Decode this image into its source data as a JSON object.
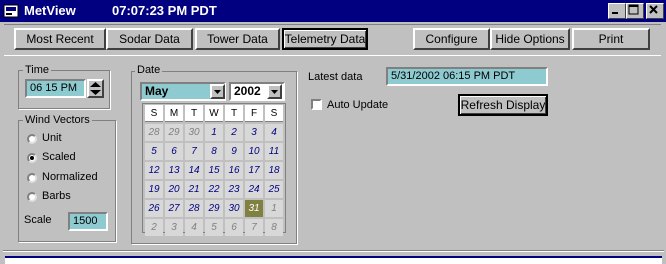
{
  "app": {
    "title": "MetView",
    "clock": "07:07:23 PM PDT"
  },
  "toolbar": {
    "tabs": [
      "Most Recent",
      "Sodar Data",
      "Tower Data",
      "Telemetry Data"
    ],
    "active_tab": "Telemetry Data",
    "actions": [
      "Configure",
      "Hide Options",
      "Print"
    ]
  },
  "time_group": {
    "label": "Time",
    "value": "06  15 PM"
  },
  "wind_vectors": {
    "label": "Wind Vectors",
    "options": [
      "Unit",
      "Scaled",
      "Normalized",
      "Barbs"
    ],
    "selected": "Scaled",
    "scale_label": "Scale",
    "scale_value": "1500"
  },
  "date_group": {
    "label": "Date",
    "month": "May",
    "year": "2002",
    "weekdays": [
      "S",
      "M",
      "T",
      "W",
      "T",
      "F",
      "S"
    ],
    "weeks": [
      [
        "28",
        "29",
        "30",
        "1",
        "2",
        "3",
        "4"
      ],
      [
        "5",
        "6",
        "7",
        "8",
        "9",
        "10",
        "11"
      ],
      [
        "12",
        "13",
        "14",
        "15",
        "16",
        "17",
        "18"
      ],
      [
        "19",
        "20",
        "21",
        "22",
        "23",
        "24",
        "25"
      ],
      [
        "26",
        "27",
        "28",
        "29",
        "30",
        "31",
        "1"
      ],
      [
        "2",
        "3",
        "4",
        "5",
        "6",
        "7",
        "8"
      ]
    ],
    "selected_day": "31"
  },
  "latest": {
    "label": "Latest data",
    "value": "5/31/2002  06:15 PM PDT"
  },
  "auto_update": {
    "label": "Auto Update",
    "checked": false
  },
  "refresh_label": "Refresh Display",
  "colors": {
    "titlebar": "#000080",
    "field": "#8ecbd0",
    "day_current": "#000080",
    "day_other": "#808080",
    "selected_day_bg": "#808040"
  }
}
